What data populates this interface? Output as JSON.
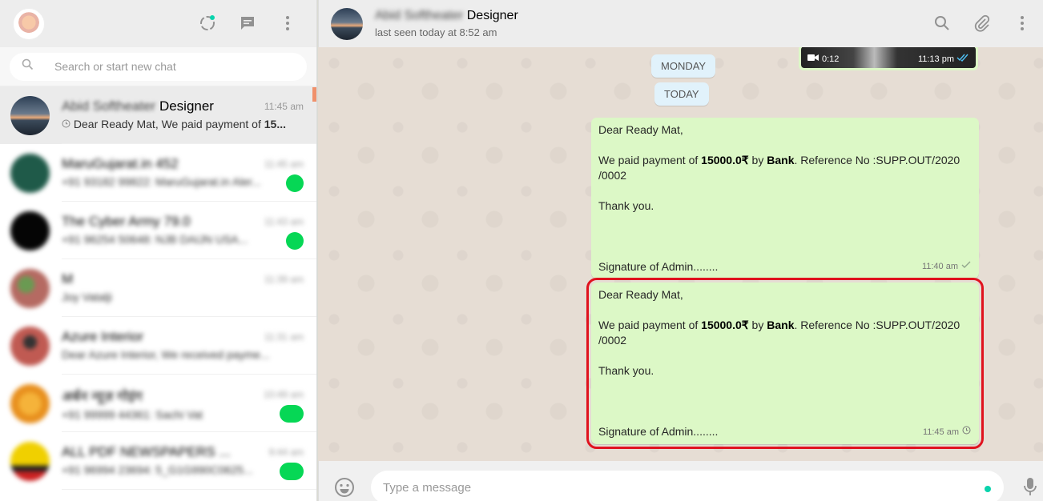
{
  "colors": {
    "accent": "#00bfa5",
    "bubble_out": "#dcf8c6",
    "highlight": "#e0121e",
    "unread": "#06d755"
  },
  "sidebar": {
    "search": {
      "placeholder": "Search or start new chat"
    },
    "chats": [
      {
        "name_blurred": "Abid Softheater",
        "name": "Designer",
        "time": "11:45 am",
        "preview": "Dear Ready Mat, We paid payment of 15...",
        "preview_bold": "15...",
        "preview_plain": "Dear Ready Mat, We paid payment of ",
        "avatar_color": "#2e3d4f"
      },
      {
        "name_blurred": "MaruGujarat.in 452",
        "time": "11:45 am",
        "preview": "+91 93182 99822: MaruGujarat.in Aler...",
        "avatar_color": "#1f5a49"
      },
      {
        "name_blurred": "The Cyber Army 79.0",
        "time": "11:43 am",
        "preview": "+91 96254 50648: NJB DAIJN USA...",
        "avatar_color": "#050505"
      },
      {
        "name_blurred": "M",
        "time": "11:39 am",
        "preview": "Joy Vatalji",
        "avatar_color": "#b56a62"
      },
      {
        "name_blurred": "Azure Interior",
        "time": "11:31 am",
        "preview": "Dear Azure Interior, We received payme...",
        "avatar_color": "#c05a52"
      },
      {
        "name_blurred": "अर्बन न्यूज़ गोइंग",
        "time": "10:49 am",
        "preview": "+91 99999 44361: Sachi Vat",
        "avatar_color": "#e8901e"
      },
      {
        "name_blurred": "ALL PDF NEWSPAPERS ...",
        "time": "9:44 am",
        "preview": "+91 96994 23694: 5_G1G990C0625...",
        "avatar_color": "#d9b41a"
      }
    ]
  },
  "conversation": {
    "name_blurred": "Abid Softheater",
    "name": "Designer",
    "status": "last seen today at 8:52 am",
    "video": {
      "duration": "0:12",
      "time": "11:13 pm"
    },
    "day_chips": [
      "MONDAY",
      "TODAY"
    ],
    "messages": [
      {
        "greeting": "Dear Ready Mat,",
        "pay_prefix": "We paid payment of ",
        "amount": "15000.0₹",
        "by": " by  ",
        "method": "Bank",
        "ref": ". Reference No :SUPP.OUT/2020",
        "ref2": "/0002",
        "thanks": "Thank you.",
        "signature": "Signature of Admin........",
        "time": "11:40 am",
        "status": "sent"
      },
      {
        "greeting": "Dear Ready Mat,",
        "pay_prefix": "We paid payment of ",
        "amount": "15000.0₹",
        "by": " by  ",
        "method": "Bank",
        "ref": ". Reference No :SUPP.OUT/2020",
        "ref2": "/0002",
        "thanks": "Thank you.",
        "signature": "Signature of Admin........",
        "time": "11:45 am",
        "status": "pending"
      }
    ]
  },
  "compose": {
    "placeholder": "Type a message"
  },
  "icons": [
    "status-icon",
    "new-chat-icon",
    "menu-icon",
    "search-icon",
    "attach-icon",
    "emoji-icon",
    "mic-icon",
    "clock-icon",
    "check-icon",
    "double-check-icon",
    "video-icon"
  ]
}
